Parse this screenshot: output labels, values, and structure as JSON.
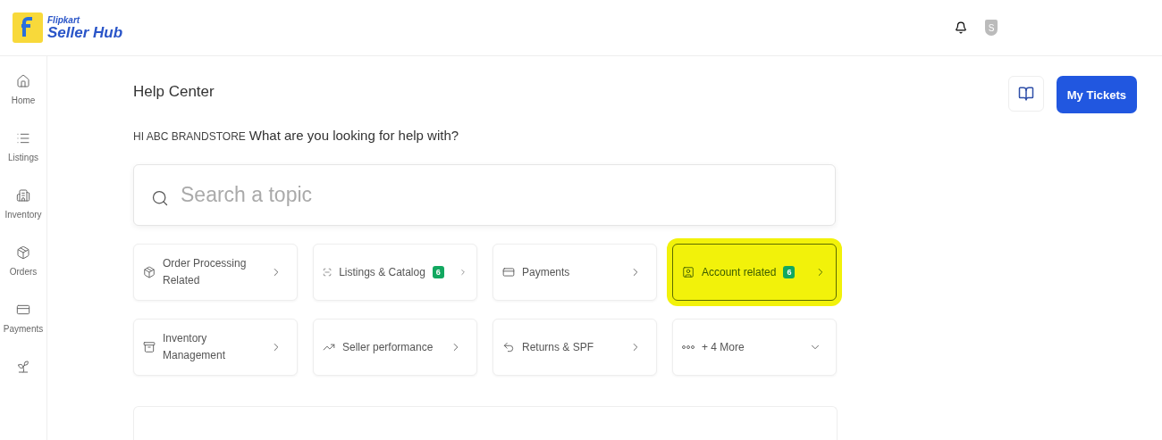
{
  "header": {
    "logo_small": "Flipkart",
    "logo_large": "Seller Hub",
    "avatar_letter": "S"
  },
  "sidebar": {
    "items": [
      {
        "label": "Home"
      },
      {
        "label": "Listings"
      },
      {
        "label": "Inventory"
      },
      {
        "label": "Orders"
      },
      {
        "label": "Payments"
      }
    ]
  },
  "title": "Help Center",
  "greeting": {
    "name": "HI ABC BRANDSTORE",
    "question": "What are you looking for help with?"
  },
  "search": {
    "placeholder": "Search a topic"
  },
  "my_tickets_button": "My Tickets",
  "topics": [
    {
      "label": "Order Processing Related",
      "highlighted": false,
      "expandable": false
    },
    {
      "label": "Listings & Catalog",
      "badge": "6",
      "highlighted": false,
      "expandable": false
    },
    {
      "label": "Payments",
      "highlighted": false,
      "expandable": false
    },
    {
      "label": "Account related",
      "badge": "6",
      "highlighted": true,
      "expandable": false
    },
    {
      "label": "Inventory Management",
      "highlighted": false,
      "expandable": false
    },
    {
      "label": "Seller performance",
      "highlighted": false,
      "expandable": false
    },
    {
      "label": "Returns & SPF",
      "highlighted": false,
      "expandable": false
    },
    {
      "label": "+ 4 More",
      "highlighted": false,
      "expandable": true
    }
  ]
}
